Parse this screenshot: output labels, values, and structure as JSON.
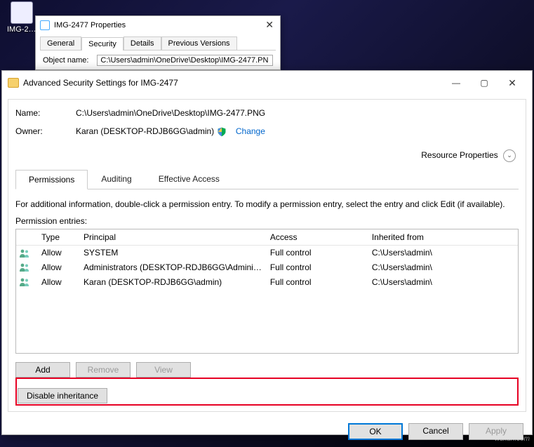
{
  "desktop": {
    "icon_label": "IMG-2…"
  },
  "props": {
    "title": "IMG-2477 Properties",
    "tabs": [
      "General",
      "Security",
      "Details",
      "Previous Versions"
    ],
    "object_name_label": "Object name:",
    "object_name_value": "C:\\Users\\admin\\OneDrive\\Desktop\\IMG-2477.PN"
  },
  "adv": {
    "title": "Advanced Security Settings for IMG-2477",
    "name_label": "Name:",
    "name_value": "C:\\Users\\admin\\OneDrive\\Desktop\\IMG-2477.PNG",
    "owner_label": "Owner:",
    "owner_value": "Karan (DESKTOP-RDJB6GG\\admin)",
    "change_link": "Change",
    "resprops": "Resource Properties",
    "tabs": [
      "Permissions",
      "Auditing",
      "Effective Access"
    ],
    "help_text": "For additional information, double-click a permission entry. To modify a permission entry, select the entry and click Edit (if available).",
    "entries_label": "Permission entries:",
    "columns": {
      "type": "Type",
      "principal": "Principal",
      "access": "Access",
      "inherited": "Inherited from"
    },
    "rows": [
      {
        "type": "Allow",
        "principal": "SYSTEM",
        "access": "Full control",
        "inherited": "C:\\Users\\admin\\"
      },
      {
        "type": "Allow",
        "principal": "Administrators (DESKTOP-RDJB6GG\\Admini…",
        "access": "Full control",
        "inherited": "C:\\Users\\admin\\"
      },
      {
        "type": "Allow",
        "principal": "Karan (DESKTOP-RDJB6GG\\admin)",
        "access": "Full control",
        "inherited": "C:\\Users\\admin\\"
      }
    ],
    "buttons": {
      "add": "Add",
      "remove": "Remove",
      "view": "View",
      "disable_inherit": "Disable inheritance",
      "ok": "OK",
      "cancel": "Cancel",
      "apply": "Apply"
    }
  },
  "watermark": "wsxdn.com"
}
